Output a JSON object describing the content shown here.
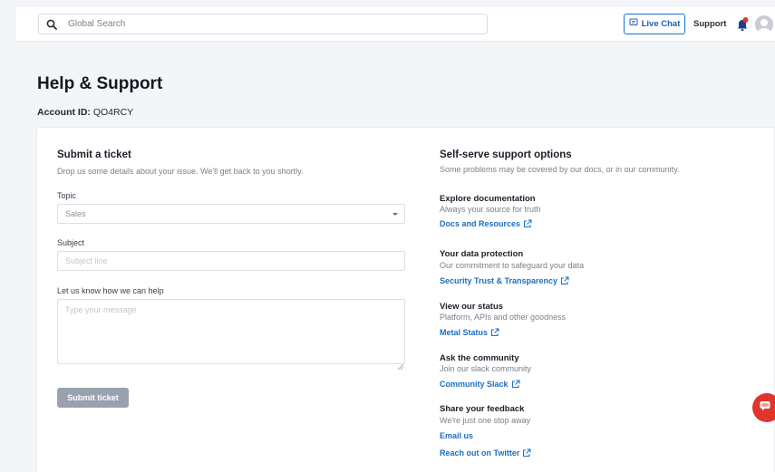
{
  "topbar": {
    "search_placeholder": "Global Search",
    "live_chat_label": "Live Chat",
    "support_label": "Support"
  },
  "page": {
    "title": "Help & Support",
    "account_label": "Account ID:",
    "account_id": "QO4RCY"
  },
  "ticket": {
    "title": "Submit a ticket",
    "subtitle": "Drop us some details about your issue. We'll get back to you shortly.",
    "topic_label": "Topic",
    "topic_value": "Sales",
    "subject_label": "Subject",
    "subject_placeholder": "Subject line",
    "message_label": "Let us know how we can help",
    "message_placeholder": "Type your message",
    "submit_label": "Submit ticket"
  },
  "self_serve": {
    "title": "Self-serve support options",
    "subtitle": "Some problems may be covered by our docs, or in our community.",
    "options": [
      {
        "title": "Explore documentation",
        "desc": "Always your source for truth",
        "link": "Docs and Resources"
      },
      {
        "title": "Your data protection",
        "desc": "Our commitment to safeguard your data",
        "link": "Security Trust & Transparency"
      },
      {
        "title": "View our status",
        "desc": "Platform, APIs and other goodness",
        "link": "Metal Status"
      },
      {
        "title": "Ask the community",
        "desc": "Join our slack community",
        "link": "Community Slack"
      },
      {
        "title": "Share your feedback",
        "desc": "We're just one stop away",
        "link": "Email us",
        "link2": "Reach out on Twitter"
      }
    ]
  },
  "colors": {
    "accent": "#1a6fc2",
    "alert": "#e0352b",
    "button_disabled": "#9aa1ae"
  }
}
